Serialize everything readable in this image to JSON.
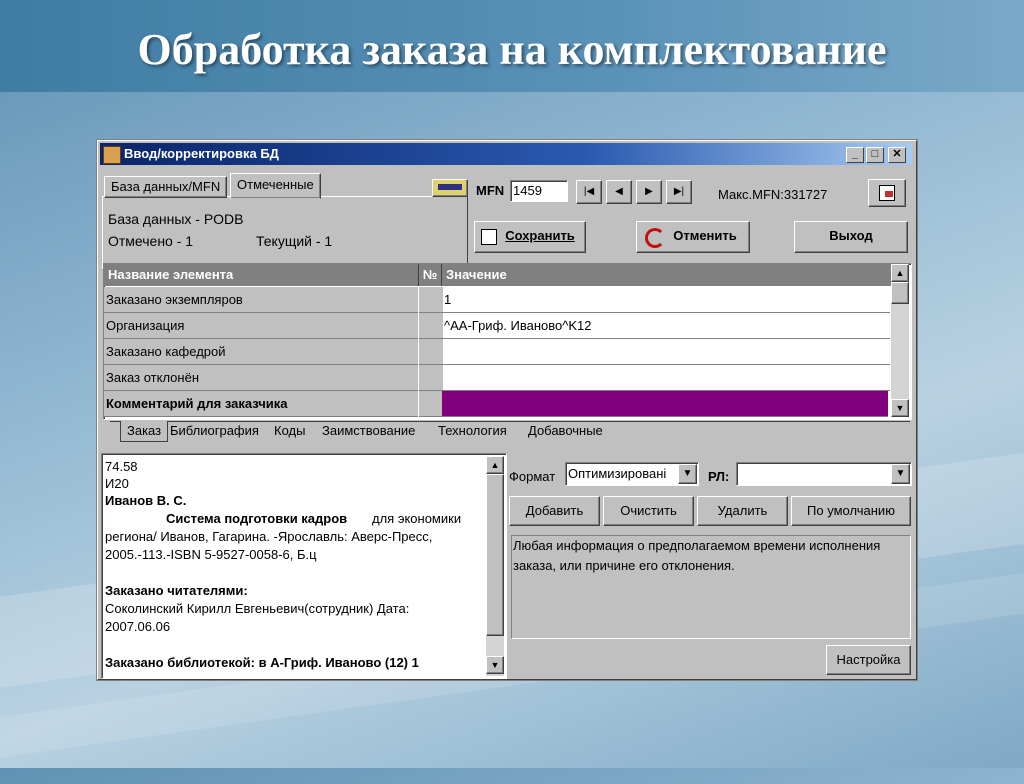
{
  "slide": {
    "title": "Обработка заказа на комплектование"
  },
  "window": {
    "title": "Ввод/корректировка БД",
    "min": "_",
    "max": "□",
    "close": "✕"
  },
  "left_tabs": [
    {
      "label": "База данных/MFN"
    },
    {
      "label": "Отмеченные"
    }
  ],
  "left_info": {
    "database": "База данных -  PODB",
    "marked": "Отмечено - 1",
    "current": "Текущий - 1"
  },
  "mfn": {
    "label": "MFN",
    "value": "1459",
    "max_label": "Макс.MFN:331727"
  },
  "nav": {
    "first": "|◀",
    "prev": "◀",
    "next": "▶",
    "last": "▶|"
  },
  "actions": {
    "save": "Сохранить",
    "cancel": "Отменить",
    "exit": "Выход"
  },
  "grid": {
    "headers": {
      "name": "Название элемента",
      "num": "№",
      "value": "Значение"
    },
    "rows": [
      {
        "name": "Заказано экземпляров",
        "num": "",
        "value": "1"
      },
      {
        "name": "Организация",
        "num": "",
        "value": "^AА-Гриф. Иваново^K12"
      },
      {
        "name": "Заказано кафедрой",
        "num": "",
        "value": ""
      },
      {
        "name": "Заказ отклонён",
        "num": "",
        "value": ""
      },
      {
        "name": "Комментарий для заказчика",
        "num": "",
        "value": ""
      }
    ],
    "selected_color": "#800080"
  },
  "bottom_tabs": [
    "Заказ",
    "Библиография",
    "Коды",
    "Заимствование",
    "Технология",
    "Добавочные"
  ],
  "record": {
    "lines": [
      "74.58",
      "И20",
      "Иванов В. С.",
      "Система подготовки кадров",
      "для экономики",
      "региона/ Иванов, Гагарина. -Ярославль: Аверс-Пресс,",
      "2005.-113.-ISBN 5-9527-0058-6, Б.ц",
      "Заказано читателями:",
      "Соколинский Кирилл Евгеньевич(сотрудник) Дата:",
      "2007.06.06",
      "Заказано библиотекой: в  А-Гриф. Иваново (12)  1"
    ]
  },
  "format": {
    "label": "Формат",
    "value": "Оптимизировані",
    "rl_label": "РЛ:",
    "rl_value": ""
  },
  "buttons": {
    "add": "Добавить",
    "clear": "Очистить",
    "delete": "Удалить",
    "default": "По умолчанию",
    "settings": "Настройка"
  },
  "help_text": {
    "line1": "Любая информация о предполагаемом времени исполнения",
    "line2": "заказа, или причине его отклонения."
  }
}
